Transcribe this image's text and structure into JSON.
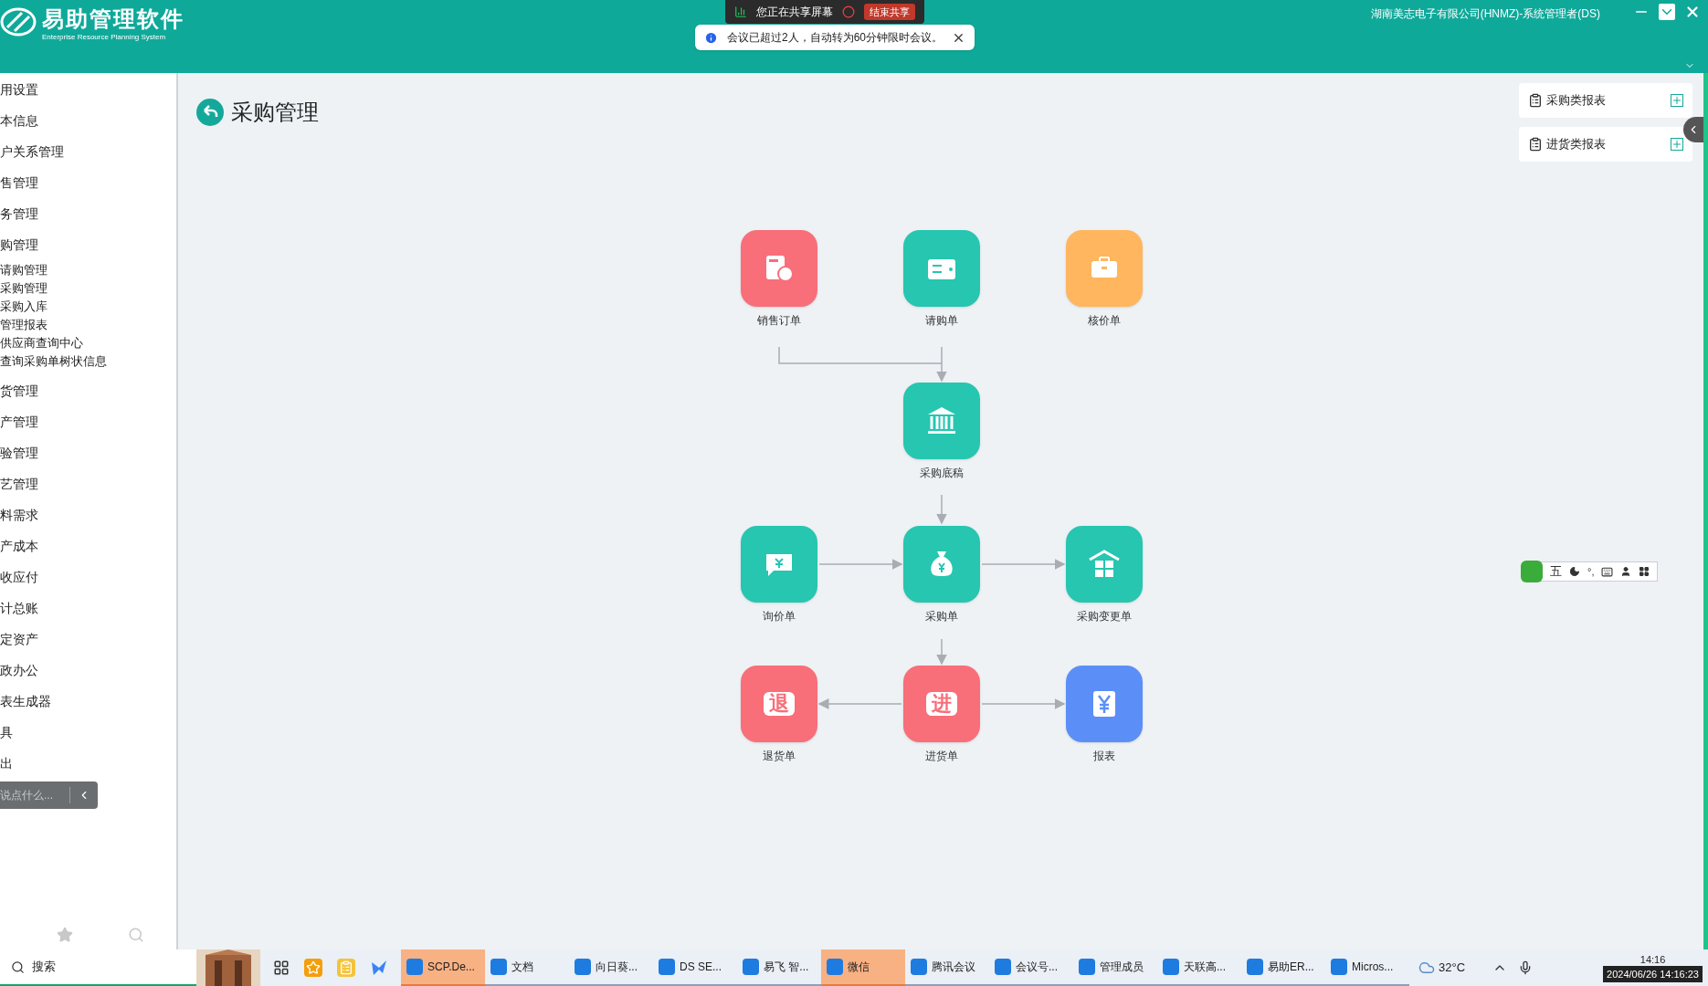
{
  "header": {
    "logo_title": "易助管理软件",
    "logo_subtitle": "Enterprise Resource Planning System",
    "company_user": "湖南美志电子有限公司(HNMZ)-系统管理者(DS)"
  },
  "share_bar": {
    "status": "您正在共享屏幕",
    "stop_button": "结束共享"
  },
  "notice": {
    "message": "会议已超过2人，自动转为60分钟限时会议。"
  },
  "sidebar": {
    "items": [
      {
        "label": "用设置"
      },
      {
        "label": "本信息"
      },
      {
        "label": "户关系管理"
      },
      {
        "label": "售管理"
      },
      {
        "label": "务管理"
      },
      {
        "label": "购管理",
        "children": [
          {
            "label": "请购管理"
          },
          {
            "label": "采购管理"
          },
          {
            "label": "采购入库"
          },
          {
            "label": "管理报表"
          },
          {
            "label": "供应商查询中心"
          },
          {
            "label": "查询采购单树状信息"
          }
        ]
      },
      {
        "label": "货管理"
      },
      {
        "label": "产管理"
      },
      {
        "label": "验管理"
      },
      {
        "label": "艺管理"
      },
      {
        "label": "料需求"
      },
      {
        "label": "产成本"
      },
      {
        "label": "收应付"
      },
      {
        "label": "计总账"
      },
      {
        "label": "定资产"
      },
      {
        "label": "政办公"
      },
      {
        "label": "表生成器"
      },
      {
        "label": "具"
      },
      {
        "label": "出"
      }
    ],
    "chat_placeholder": "说点什么..."
  },
  "page": {
    "title": "采购管理"
  },
  "flow_nodes": [
    {
      "label": "销售订单",
      "color": "#f86e79"
    },
    {
      "label": "请购单",
      "color": "#26c6b0"
    },
    {
      "label": "核价单",
      "color": "#ffb65e"
    },
    {
      "label": "采购底稿",
      "color": "#26c6b0"
    },
    {
      "label": "询价单",
      "color": "#26c6b0"
    },
    {
      "label": "采购单",
      "color": "#26c6b0"
    },
    {
      "label": "采购变更单",
      "color": "#26c6b0"
    },
    {
      "label": "退货单",
      "color": "#f86e79",
      "glyph": "退"
    },
    {
      "label": "进货单",
      "color": "#f86e79",
      "glyph": "进"
    },
    {
      "label": "报表",
      "color": "#5b8ff7"
    }
  ],
  "reports": [
    {
      "label": "采购类报表"
    },
    {
      "label": "进货类报表"
    }
  ],
  "ime_toolbar": {
    "layout": "五",
    "punct": "°,"
  },
  "taskbar": {
    "search": "搜索",
    "apps": [
      {
        "label": "SCP.De...",
        "selected": true
      },
      {
        "label": "文档",
        "selected": false
      },
      {
        "label": "向日葵...",
        "selected": false
      },
      {
        "label": "DS SE...",
        "selected": false
      },
      {
        "label": "易飞 智...",
        "selected": false
      },
      {
        "label": "微信",
        "selected": true
      },
      {
        "label": "腾讯会议",
        "selected": false
      },
      {
        "label": "会议号...",
        "selected": false
      },
      {
        "label": "管理成员",
        "selected": false
      },
      {
        "label": "天联高...",
        "selected": false
      },
      {
        "label": "易助ER...",
        "selected": false
      },
      {
        "label": "Micros...",
        "selected": false
      }
    ],
    "temperature": "32°C",
    "time": "14:16",
    "datetime": "2024/06/26 14:16:23"
  }
}
